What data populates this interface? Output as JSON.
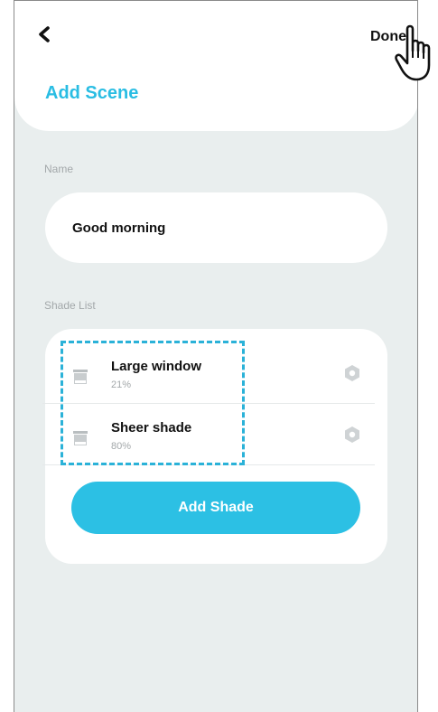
{
  "header": {
    "back_icon": "chevron-left-icon",
    "done_label": "Done",
    "title": "Add Scene"
  },
  "name_section": {
    "label": "Name",
    "value": "Good morning"
  },
  "shade_section": {
    "label": "Shade List",
    "items": [
      {
        "name": "Large window",
        "percent": "21%",
        "icon": "shade-icon",
        "settings_icon": "gear-icon"
      },
      {
        "name": "Sheer shade",
        "percent": "80%",
        "icon": "shade-icon",
        "settings_icon": "gear-icon"
      }
    ],
    "add_button_label": "Add Shade"
  },
  "colors": {
    "accent": "#29bde3",
    "background": "#e9eeee",
    "highlight_dash": "#2bb2d8"
  }
}
